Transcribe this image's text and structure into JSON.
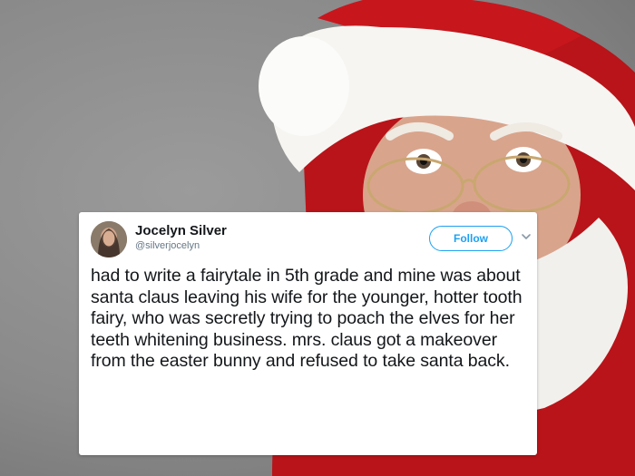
{
  "tweet": {
    "author_name": "Jocelyn Silver",
    "author_handle": "@silverjocelyn",
    "follow_label": "Follow",
    "text": "had to write a fairytale in 5th grade and mine was about santa claus leaving his wife for the younger, hotter tooth fairy, who was secretly trying to poach the elves for her teeth whitening business. mrs. claus got a makeover from the easter bunny and refused to take santa back."
  },
  "icons": {
    "menu": "chevron-down-icon",
    "avatar": "avatar"
  },
  "colors": {
    "accent": "#1da1f2",
    "text": "#14171a",
    "muted": "#657786",
    "santa_red": "#c8161d"
  }
}
